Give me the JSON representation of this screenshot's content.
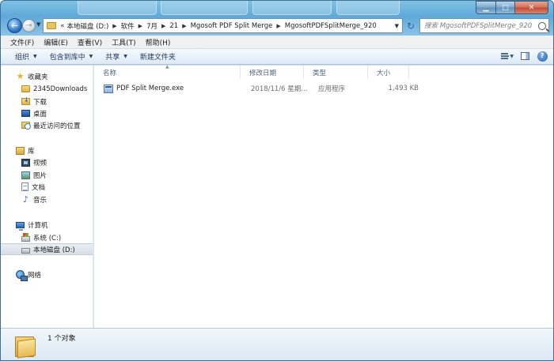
{
  "address": {
    "lead": "«",
    "crumbs": [
      "本地磁盘 (D:)",
      "软件",
      "7月",
      "21",
      "Mgosoft PDF Split Merge",
      "MgosoftPDFSplitMerge_920"
    ]
  },
  "search": {
    "placeholder": "搜索 MgosoftPDFSplitMerge_920"
  },
  "menu": [
    "文件(F)",
    "编辑(E)",
    "查看(V)",
    "工具(T)",
    "帮助(H)"
  ],
  "toolbar": {
    "organize": "组织",
    "include_library": "包含到库中",
    "share": "共享",
    "new_folder": "新建文件夹"
  },
  "sidebar": {
    "favorites": {
      "label": "收藏夹",
      "items": [
        "2345Downloads",
        "下载",
        "桌面",
        "最近访问的位置"
      ]
    },
    "libraries": {
      "label": "库",
      "items": [
        "视频",
        "图片",
        "文档",
        "音乐"
      ]
    },
    "computer": {
      "label": "计算机",
      "items": [
        "系统 (C:)",
        "本地磁盘 (D:)"
      ]
    },
    "network": {
      "label": "网络"
    }
  },
  "columns": {
    "name": "名称",
    "date": "修改日期",
    "type": "类型",
    "size": "大小"
  },
  "files": [
    {
      "name": "PDF Split Merge.exe",
      "date": "2018/11/6 星期...",
      "type": "应用程序",
      "size": "1,493 KB"
    }
  ],
  "status": {
    "count": "1 个对象"
  }
}
